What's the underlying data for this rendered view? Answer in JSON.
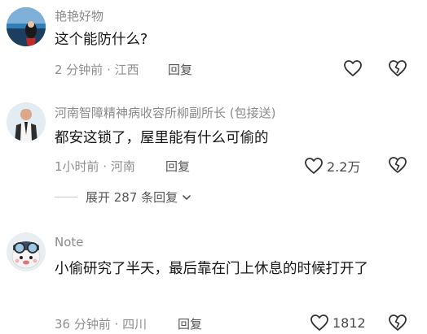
{
  "comments": [
    {
      "username": "艳艳好物",
      "text": "这个能防什么?",
      "time_location": "2 分钟前 · 江西",
      "reply_label": "回复",
      "like_count": ""
    },
    {
      "username": "河南智障精神病收容所柳副所长 (包接送)",
      "text": "都安这锁了，屋里能有什么可偷的",
      "time_location": "1小时前 · 河南",
      "reply_label": "回复",
      "like_count": "2.2万"
    },
    {
      "username": "Note",
      "text": "小偷研究了半天，最后靠在门上休息的时候打开了",
      "time_location": "36 分钟前 · 四川",
      "reply_label": "回复",
      "like_count": "1812"
    }
  ],
  "expand_replies": "展开 287 条回复",
  "colors": {
    "muted": "#8a8a8a",
    "text": "#161616"
  },
  "icons": [
    "heart-icon",
    "broken-heart-icon",
    "chevron-down-icon"
  ]
}
